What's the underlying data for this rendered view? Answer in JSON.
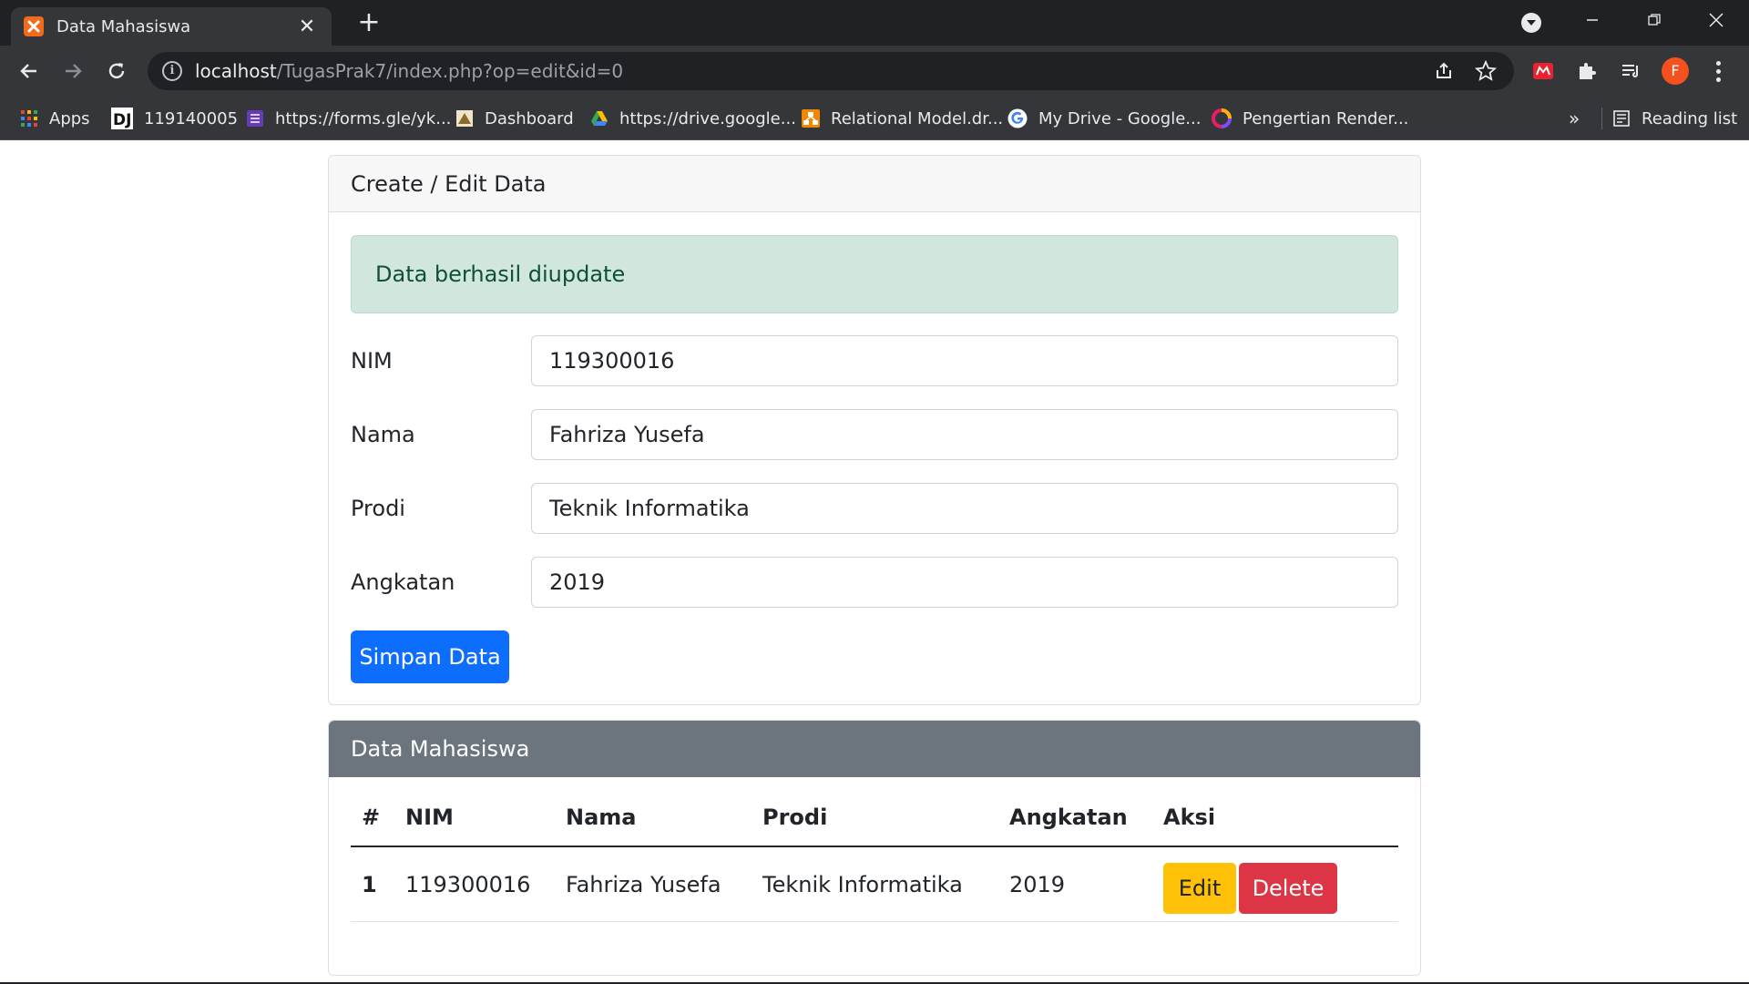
{
  "browser": {
    "tab_title": "Data Mahasiswa",
    "tab_close": "✕",
    "new_tab": "+",
    "url_host": "localhost",
    "url_path": "/TugasPrak7/index.php?op=edit&id=0",
    "profile_initial": "F",
    "bookmarks": [
      {
        "label": "Apps",
        "icon": "apps-grid-icon"
      },
      {
        "label": "119140005",
        "icon": "dj-icon"
      },
      {
        "label": "https://forms.gle/yk...",
        "icon": "google-forms-icon"
      },
      {
        "label": "Dashboard",
        "icon": "itera-icon"
      },
      {
        "label": "https://drive.google...",
        "icon": "google-drive-icon"
      },
      {
        "label": "Relational Model.dr...",
        "icon": "drawio-icon"
      },
      {
        "label": "My Drive - Google...",
        "icon": "google-icon"
      },
      {
        "label": "Pengertian Render...",
        "icon": "colorful-circle-icon"
      }
    ],
    "bookmarks_more": "»",
    "reading_list": "Reading list"
  },
  "form_card": {
    "header": "Create / Edit Data",
    "alert": "Data berhasil diupdate",
    "fields": {
      "nim": {
        "label": "NIM",
        "value": "119300016"
      },
      "nama": {
        "label": "Nama",
        "value": "Fahriza Yusefa"
      },
      "prodi": {
        "label": "Prodi",
        "value": "Teknik Informatika"
      },
      "angkatan": {
        "label": "Angkatan",
        "value": "2019"
      }
    },
    "submit_label": "Simpan Data"
  },
  "table_card": {
    "header": "Data Mahasiswa",
    "columns": [
      "#",
      "NIM",
      "Nama",
      "Prodi",
      "Angkatan",
      "Aksi"
    ],
    "rows": [
      {
        "no": "1",
        "nim": "119300016",
        "nama": "Fahriza Yusefa",
        "prodi": "Teknik Informatika",
        "angkatan": "2019",
        "edit": "Edit",
        "delete": "Delete"
      }
    ]
  },
  "colors": {
    "primary": "#0d6efd",
    "warning": "#ffc107",
    "danger": "#dc3545",
    "secondary": "#6c757d",
    "success_bg": "#d1e7dd"
  }
}
